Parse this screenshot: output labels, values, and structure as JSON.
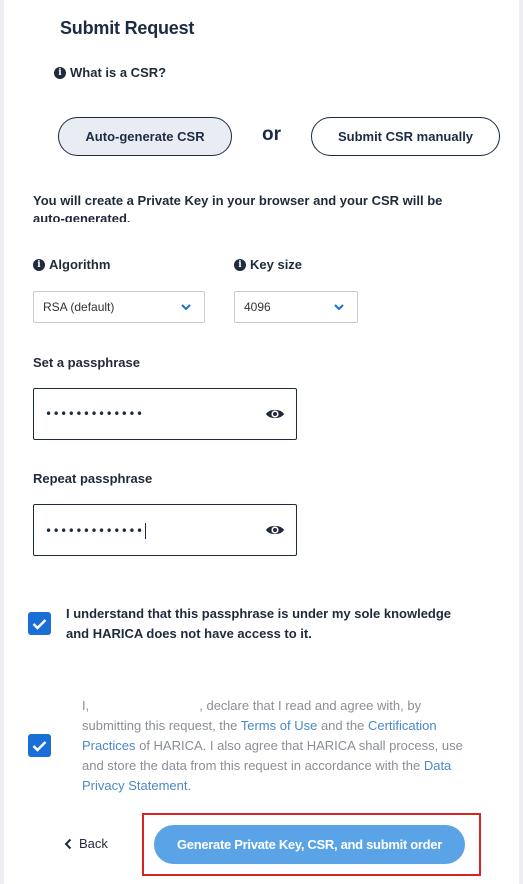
{
  "title": "Submit Request",
  "csr_help": {
    "label": "What is a CSR?",
    "icon": "info-icon"
  },
  "mode": {
    "auto_label": "Auto-generate CSR",
    "or_label": "or",
    "manual_label": "Submit CSR manually",
    "selected": "auto"
  },
  "description": "You will create a Private Key in your browser and your CSR will be auto-generated.",
  "algorithm": {
    "label": "Algorithm",
    "value": "RSA (default)"
  },
  "key_size": {
    "label": "Key size",
    "value": "4096"
  },
  "passphrase": {
    "label": "Set a passphrase",
    "masked": "•••••••••••••",
    "icon": "eye-icon"
  },
  "repeat_passphrase": {
    "label": "Repeat passphrase",
    "masked": "•••••••••••••",
    "icon": "eye-icon"
  },
  "acknowledge": {
    "checked": true,
    "text": "I understand that this passphrase is under my sole knowledge and HARICA does not have access to it."
  },
  "consent": {
    "checked": true,
    "part1": "I,",
    "part2": ", declare that I read and agree with, by submitting this request, the",
    "terms_link": "Terms of Use",
    "part3": "and the",
    "cp_link": "Certification Practices",
    "part4": "of HARICA. I also agree that HARICA shall process, use and store the data from this request in accordance with the",
    "privacy_link": "Data Privacy Statement",
    "part5": "."
  },
  "actions": {
    "back_label": "Back",
    "submit_label": "Generate Private Key, CSR, and submit order"
  },
  "colors": {
    "accent": "#1a6fd6",
    "button": "#5aa3e6",
    "navy": "#1c2b43",
    "highlight": "#d92323",
    "link": "#4a88c8"
  }
}
